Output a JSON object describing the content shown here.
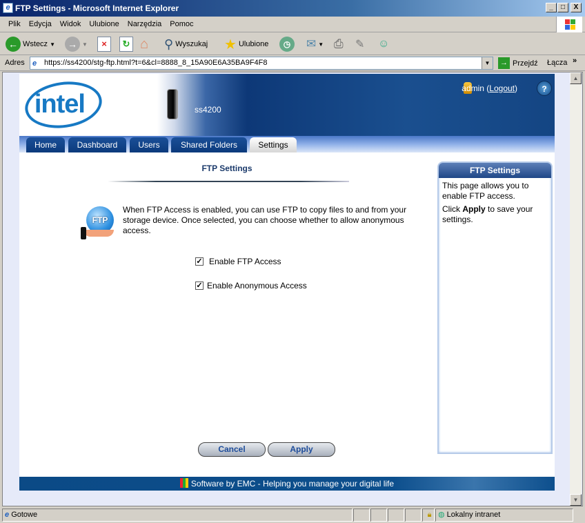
{
  "window": {
    "title": "FTP Settings - Microsoft Internet Explorer",
    "buttons": [
      "_",
      "□",
      "X"
    ]
  },
  "menu": [
    "Plik",
    "Edycja",
    "Widok",
    "Ulubione",
    "Narzędzia",
    "Pomoc"
  ],
  "toolbar": {
    "back": "Wstecz",
    "search": "Wyszukaj",
    "favorites": "Ulubione"
  },
  "address": {
    "label": "Adres",
    "url": "https://ss4200/stg-ftp.html?t=6&cl=8888_8_15A90E6A35BA9F4F8",
    "go": "Przejdź",
    "links": "Łącza"
  },
  "header": {
    "logo": "intel",
    "model": "ss4200",
    "user": "admin",
    "logout": "Logout"
  },
  "tabs": [
    {
      "label": "Home"
    },
    {
      "label": "Dashboard"
    },
    {
      "label": "Users"
    },
    {
      "label": "Shared Folders"
    },
    {
      "label": "Settings",
      "active": true
    }
  ],
  "main": {
    "title": "FTP Settings",
    "description": "When FTP Access is enabled, you can use FTP to copy files to and from your storage device. Once selected, you can choose whether to allow anonymous access.",
    "icon_text": "FTP",
    "options": [
      {
        "label": "Enable FTP Access",
        "checked": true
      },
      {
        "label": "Enable Anonymous Access",
        "checked": true
      }
    ],
    "cancel": "Cancel",
    "apply": "Apply"
  },
  "sidebar": {
    "title": "FTP Settings",
    "p1": "This page allows you to enable FTP access.",
    "p2_pre": "Click ",
    "p2_bold": "Apply",
    "p2_post": " to save your settings."
  },
  "footer": "Software by EMC - Helping you manage your digital life",
  "status": {
    "text": "Gotowe",
    "zone": "Lokalny intranet"
  },
  "colors": {
    "header_blue": "#0d3877",
    "tab_blue": "#0b3a7c",
    "button_text": "#1d4c9a"
  }
}
